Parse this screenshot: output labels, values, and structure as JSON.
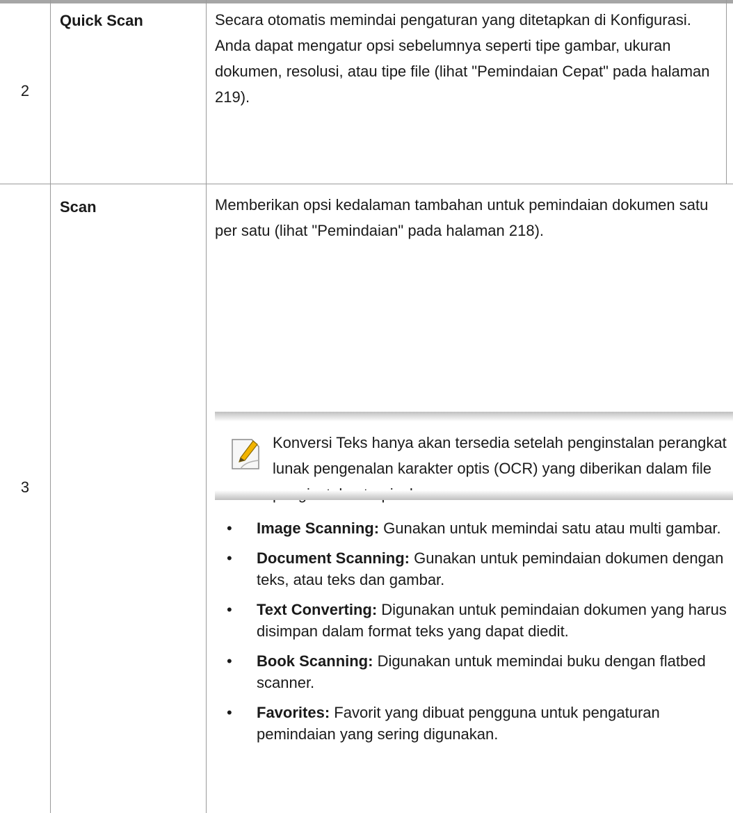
{
  "rows": [
    {
      "number": "2",
      "name": "Quick Scan",
      "description": "Secara otomatis memindai pengaturan yang ditetapkan di Konfigurasi. Anda dapat mengatur opsi sebelumnya seperti tipe gambar, ukuran dokumen, resolusi, atau tipe file (lihat \"Pemindaian Cepat\" pada halaman 219)."
    },
    {
      "number": "3",
      "name": "Scan",
      "description": "Memberikan opsi kedalaman tambahan untuk pemindaian dokumen satu per satu (lihat \"Pemindaian\" pada halaman 218).",
      "note": {
        "icon": "note-pencil-icon",
        "text": "Konversi Teks hanya akan tersedia setelah penginstalan perangkat lunak pengenalan karakter optis (OCR) yang diberikan dalam file penginstalan terpisah."
      },
      "bullets": [
        {
          "term": "Image Scanning:",
          "text": " Gunakan untuk memindai satu atau multi gambar."
        },
        {
          "term": "Document Scanning:",
          "text": " Gunakan untuk pemindaian dokumen dengan teks, atau teks dan gambar."
        },
        {
          "term": "Text Converting:",
          "text": " Digunakan untuk pemindaian dokumen yang harus disimpan dalam format teks yang dapat diedit."
        },
        {
          "term": "Book Scanning:",
          "text": " Digunakan untuk memindai buku dengan flatbed scanner."
        },
        {
          "term": "Favorites:",
          "text": " Favorit yang dibuat pengguna untuk pengaturan pemindaian yang sering digunakan."
        }
      ]
    }
  ],
  "bullet_symbol": "•",
  "colors": {
    "rule": "#9a9a9a",
    "top_bar": "#a6a6a6",
    "text": "#1a1a1a"
  }
}
